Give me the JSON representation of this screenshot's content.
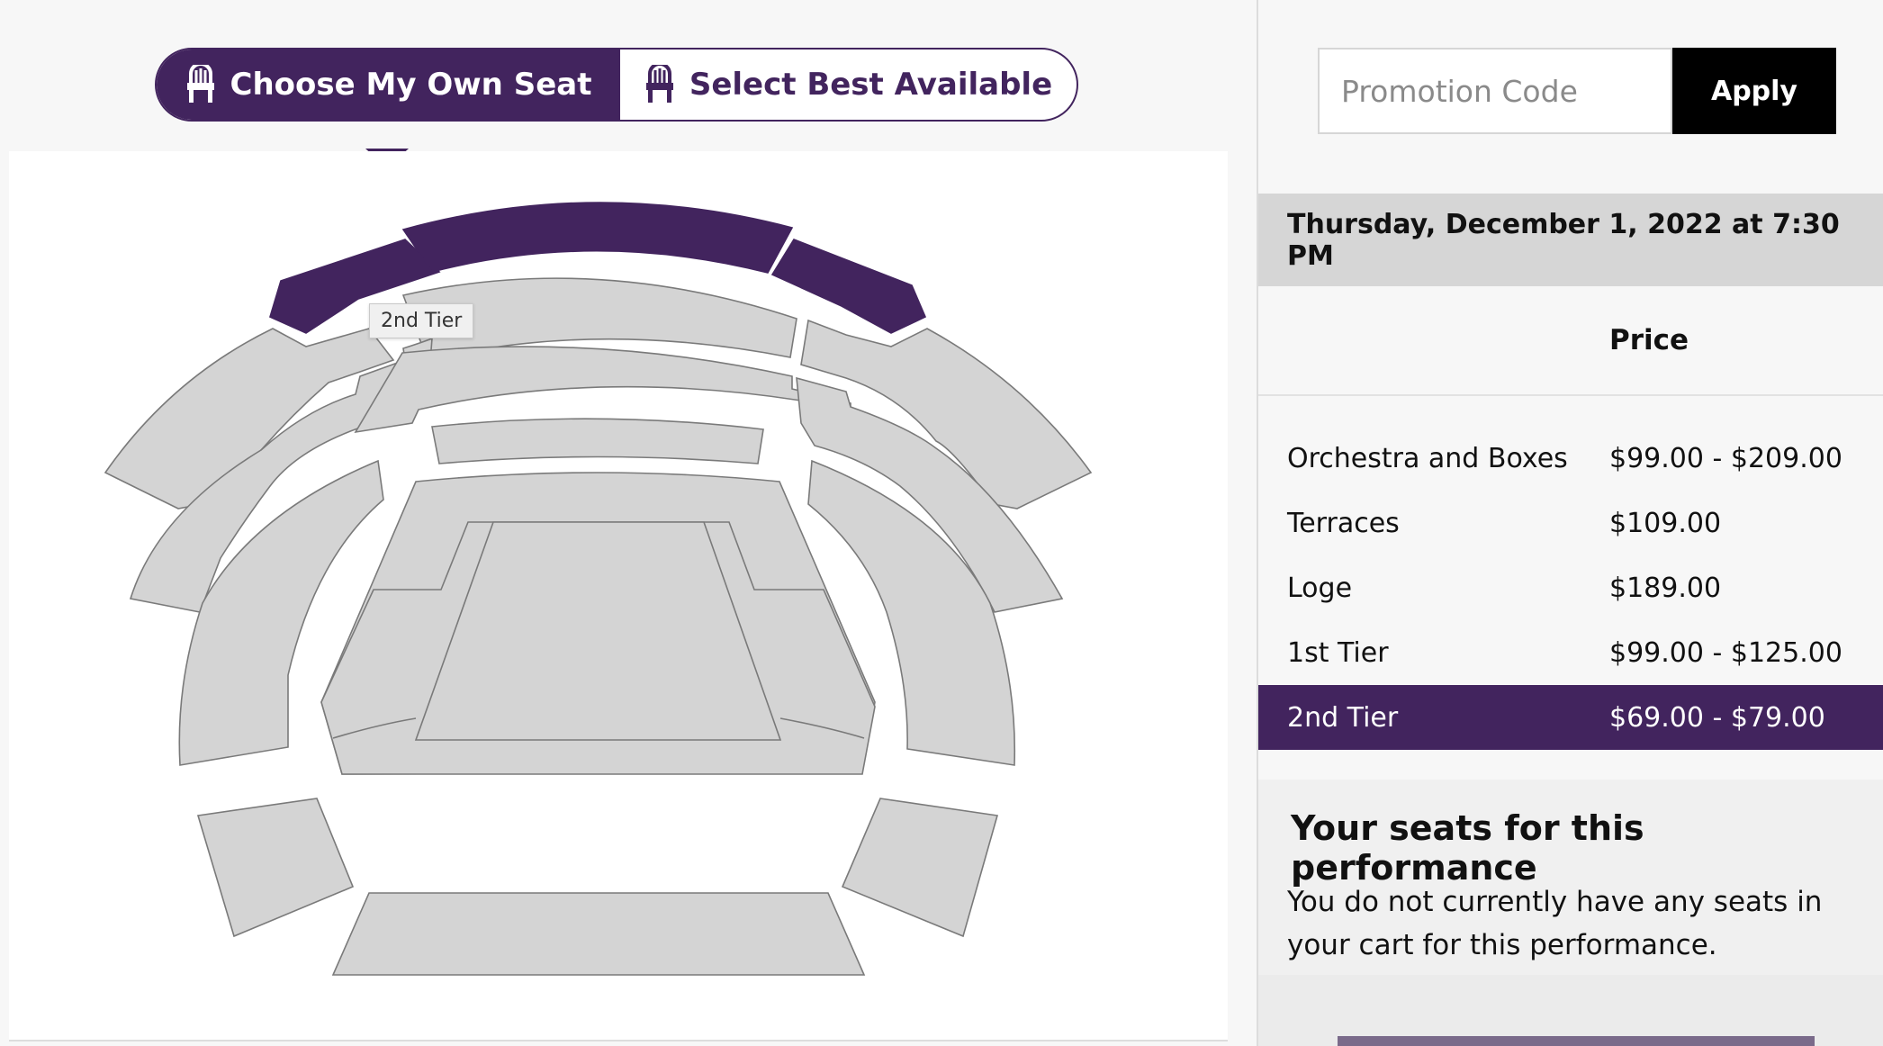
{
  "toggle": {
    "own_seat_label": "Choose My Own Seat",
    "best_available_label": "Select Best Available"
  },
  "seat_map": {
    "tooltip": "2nd Tier",
    "selected_section": "2nd Tier"
  },
  "promo": {
    "placeholder": "Promotion Code",
    "apply_label": "Apply"
  },
  "performance": {
    "date": "Thursday, December 1, 2022 at 7:30 PM"
  },
  "pricing": {
    "header": "Price",
    "rows": [
      {
        "name": "Orchestra and Boxes",
        "price": "$99.00 - $209.00"
      },
      {
        "name": "Terraces",
        "price": "$109.00"
      },
      {
        "name": "Loge",
        "price": "$189.00"
      },
      {
        "name": "1st Tier",
        "price": "$99.00 - $125.00"
      },
      {
        "name": "2nd Tier",
        "price": "$69.00 - $79.00"
      }
    ]
  },
  "cart": {
    "title": "Your seats for this performance",
    "message": "You do not currently have any seats in your cart for this performance."
  },
  "colors": {
    "accent": "#42245e",
    "section_fill": "#d4d4d4",
    "date_bar": "#d6d6d6"
  },
  "icons": {
    "seat": "chair-icon"
  }
}
